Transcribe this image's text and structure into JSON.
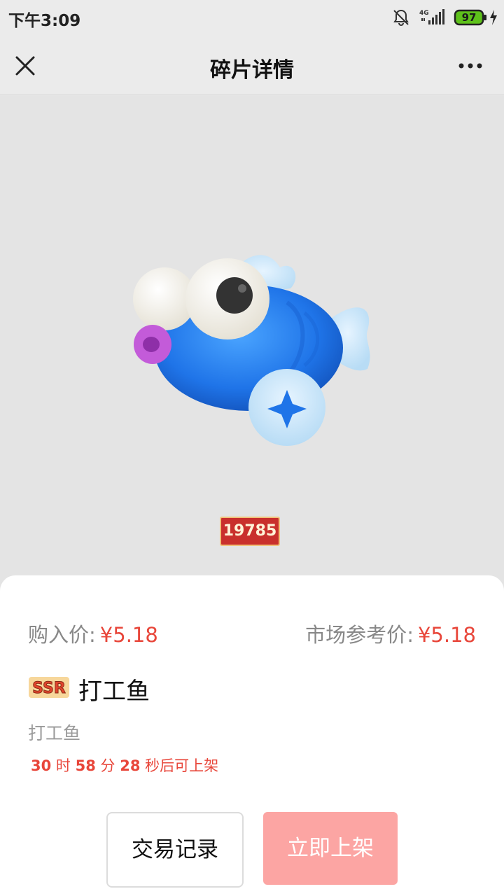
{
  "status_bar": {
    "time": "下午3:09",
    "network": "4G",
    "battery": "97",
    "icons": [
      "bell-muted-icon",
      "signal-icon",
      "battery-icon",
      "charging-icon"
    ]
  },
  "nav": {
    "title": "碎片详情",
    "close_icon": "close-icon",
    "more_icon": "more-dots-icon"
  },
  "hero": {
    "serial": "19785",
    "image": "blue-fish-illustration"
  },
  "prices": {
    "buy_label": "购入价",
    "buy_value": "¥5.18",
    "market_label": "市场参考价",
    "market_value": "¥5.18",
    "separator": ":"
  },
  "item": {
    "rarity": "SSR",
    "name": "打工鱼",
    "subtitle": "打工鱼"
  },
  "countdown": {
    "hours": "30",
    "hours_unit": "时",
    "minutes": "58",
    "minutes_unit": "分",
    "seconds": "28",
    "seconds_unit": "秒后可上架"
  },
  "actions": {
    "history_label": "交易记录",
    "list_label": "立即上架"
  },
  "colors": {
    "accent_red": "#e8463a",
    "list_button_disabled": "#fca5a3",
    "serial_badge": "#c9302c"
  }
}
